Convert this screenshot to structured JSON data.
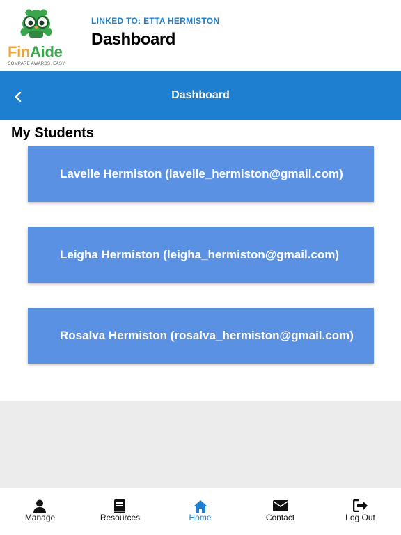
{
  "header": {
    "logo": {
      "brand_fin": "Fin",
      "brand_aide": "Aide",
      "tagline": "COMPARE AWARDS. EASY."
    },
    "linked_to": "LINKED TO: ETTA HERMISTON",
    "title": "Dashboard"
  },
  "nav": {
    "back_icon": "chevron-left-icon",
    "title": "Dashboard"
  },
  "section": {
    "heading": "My Students"
  },
  "students": [
    {
      "label": "Lavelle Hermiston (lavelle_hermiston@gmail.com)"
    },
    {
      "label": "Leigha Hermiston (leigha_hermiston@gmail.com)"
    },
    {
      "label": "Rosalva Hermiston (rosalva_hermiston@gmail.com)"
    }
  ],
  "tabs": [
    {
      "label": "Manage",
      "icon": "user-icon",
      "active": false
    },
    {
      "label": "Resources",
      "icon": "book-icon",
      "active": false
    },
    {
      "label": "Home",
      "icon": "home-icon",
      "active": true
    },
    {
      "label": "Contact",
      "icon": "envelope-icon",
      "active": false
    },
    {
      "label": "Log Out",
      "icon": "logout-icon",
      "active": false
    }
  ],
  "colors": {
    "primary_blue": "#1e7fd0",
    "card_blue": "#5b91e3",
    "brand_green": "#3aa54a",
    "brand_orange": "#e8a33d",
    "background_gray": "#ececec"
  }
}
